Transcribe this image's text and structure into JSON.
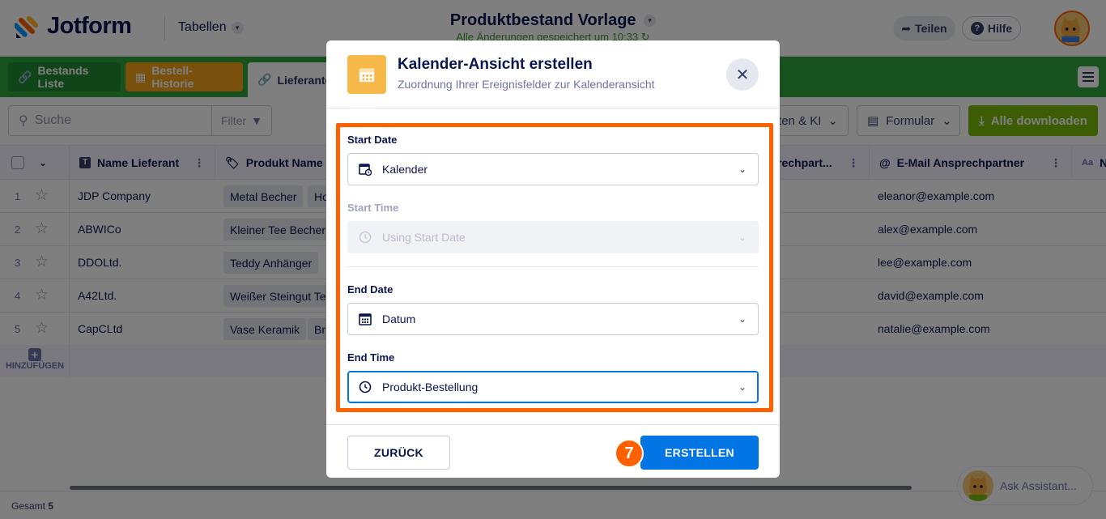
{
  "topbar": {
    "logo_text": "Jotform",
    "tables_label": "Tabellen",
    "doc_title": "Produktbestand Vorlage",
    "save_status": "Alle Änderungen gespeichert um 10:33",
    "share_label": "Teilen",
    "help_label": "Hilfe",
    "help_glyph": "?"
  },
  "tabs": [
    {
      "label": "Bestands Liste"
    },
    {
      "label": "Bestell-Historie"
    },
    {
      "label": "Lieferante"
    }
  ],
  "toolbar": {
    "search_placeholder": "Suche",
    "filter_label": "Filter",
    "ai_label": "lten & KI",
    "form_label": "Formular",
    "download_label": "Alle downloaden"
  },
  "grid": {
    "columns": [
      {
        "label": "Name Lieferant",
        "icon": "T"
      },
      {
        "label": "Produkt Name"
      },
      {
        "label": "rechpart..."
      },
      {
        "label": "E-Mail Ansprechpartner"
      },
      {
        "label": "N",
        "icon": "Aa"
      }
    ],
    "rows": [
      {
        "num": "1",
        "supplier": "JDP Company",
        "product": "Metal Becher",
        "product2": "Ho",
        "email": "eleanor@example.com"
      },
      {
        "num": "2",
        "supplier": "ABWICo",
        "product": "Kleiner Tee Becher",
        "product2": "",
        "email": "alex@example.com"
      },
      {
        "num": "3",
        "supplier": "DDOLtd.",
        "product": "Teddy Anhänger",
        "product2": "",
        "email": "lee@example.com"
      },
      {
        "num": "4",
        "supplier": "A42Ltd.",
        "product": "Weißer Steingut Te",
        "product2": "",
        "email": "david@example.com"
      },
      {
        "num": "5",
        "supplier": "CapCLtd",
        "product": "Vase Keramik",
        "product2": "Br",
        "email": "natalie@example.com"
      }
    ],
    "add_row_label": "HINZUFÜGEN",
    "add_glyph": "+",
    "star_glyph": "☆",
    "kebab_glyph": "⋮",
    "total_label": "Gesamt",
    "total_value": "5"
  },
  "assistant": {
    "label": "Ask Assistant..."
  },
  "modal": {
    "title": "Kalender-Ansicht erstellen",
    "subtitle": "Zuordnung Ihrer Ereignisfelder zur Kalenderansicht",
    "close_glyph": "✕",
    "fields": {
      "start_date": {
        "label": "Start Date",
        "value": "Kalender"
      },
      "start_time": {
        "label": "Start Time",
        "value": "Using Start Date"
      },
      "end_date": {
        "label": "End Date",
        "value": "Datum"
      },
      "end_time": {
        "label": "End Time",
        "value": "Produkt-Bestellung"
      }
    },
    "back_label": "ZURÜCK",
    "create_label": "ERSTELLEN",
    "step_number": "7"
  },
  "colors": {
    "accent": "#0075e3",
    "highlight": "#ff6100",
    "tabbar": "#2ea33d",
    "modal_icon": "#f7b84a"
  }
}
